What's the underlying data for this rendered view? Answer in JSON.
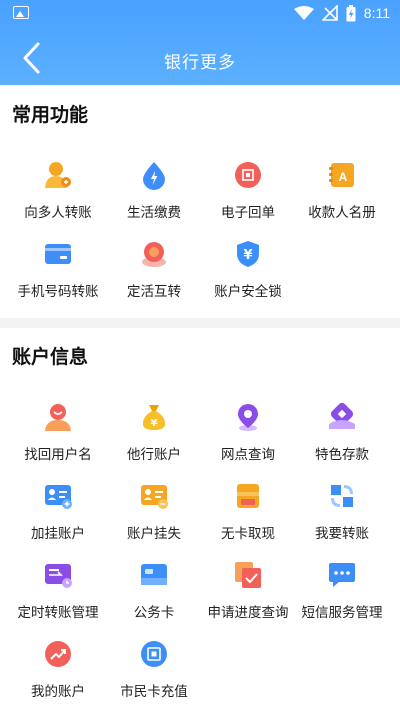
{
  "status_bar": {
    "time": "8:11"
  },
  "header": {
    "title": "银行更多"
  },
  "sections": [
    {
      "title": "常用功能",
      "items": [
        {
          "label": "向多人转账",
          "icon": "multi-transfer-icon"
        },
        {
          "label": "生活缴费",
          "icon": "utility-drop-icon"
        },
        {
          "label": "电子回单",
          "icon": "e-receipt-icon"
        },
        {
          "label": "收款人名册",
          "icon": "payee-book-icon"
        },
        {
          "label": "手机号码转账",
          "icon": "phone-transfer-card-icon"
        },
        {
          "label": "定活互转",
          "icon": "deposit-switch-icon"
        },
        {
          "label": "账户安全锁",
          "icon": "security-lock-shield-icon"
        }
      ]
    },
    {
      "title": "账户信息",
      "items": [
        {
          "label": "找回用户名",
          "icon": "user-recover-icon"
        },
        {
          "label": "他行账户",
          "icon": "money-bag-icon"
        },
        {
          "label": "网点查询",
          "icon": "location-pin-icon"
        },
        {
          "label": "特色存款",
          "icon": "special-deposit-icon"
        },
        {
          "label": "加挂账户",
          "icon": "add-account-card-icon"
        },
        {
          "label": "账户挂失",
          "icon": "report-loss-card-icon"
        },
        {
          "label": "无卡取现",
          "icon": "cardless-cash-icon"
        },
        {
          "label": "我要转账",
          "icon": "transfer-arrows-icon"
        },
        {
          "label": "定时转账管理",
          "icon": "scheduled-transfer-icon"
        },
        {
          "label": "公务卡",
          "icon": "business-card-icon"
        },
        {
          "label": "申请进度查询",
          "icon": "progress-check-icon"
        },
        {
          "label": "短信服务管理",
          "icon": "sms-bubble-icon"
        },
        {
          "label": "我的账户",
          "icon": "my-account-chart-icon"
        },
        {
          "label": "市民卡充值",
          "icon": "citizen-card-topup-icon"
        }
      ]
    }
  ]
}
